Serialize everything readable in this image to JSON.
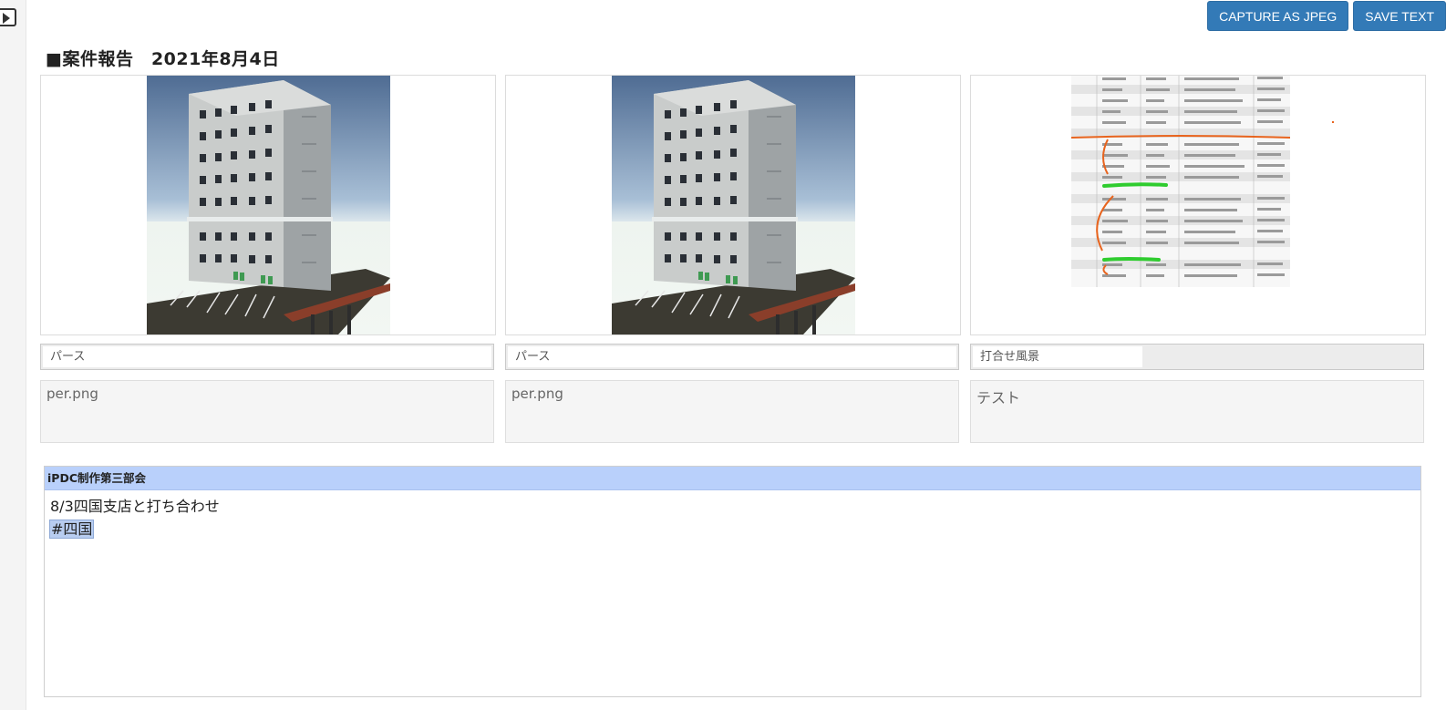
{
  "toolbar": {
    "capture_label": "CAPTURE AS JPEG",
    "save_label": "SAVE TEXT"
  },
  "page": {
    "title": "■案件報告　2021年8月4日"
  },
  "cards": [
    {
      "caption": "パース",
      "note": "per.png",
      "image": "building-render"
    },
    {
      "caption": "パース",
      "note": "per.png",
      "image": "building-render"
    },
    {
      "caption": "打合せ風景",
      "note": "テスト",
      "image": "annotated-spreadsheet"
    }
  ],
  "panel": {
    "header": "iPDC制作第三部会",
    "line1": "8/3四国支店と打ち合わせ",
    "tag": "#四国"
  },
  "colors": {
    "button": "#337ab7",
    "panel_header": "#b9d0fb",
    "markup_orange": "#e8641e",
    "markup_green": "#2fcc2f"
  },
  "icons": {
    "rail_toggle": "play-icon"
  }
}
